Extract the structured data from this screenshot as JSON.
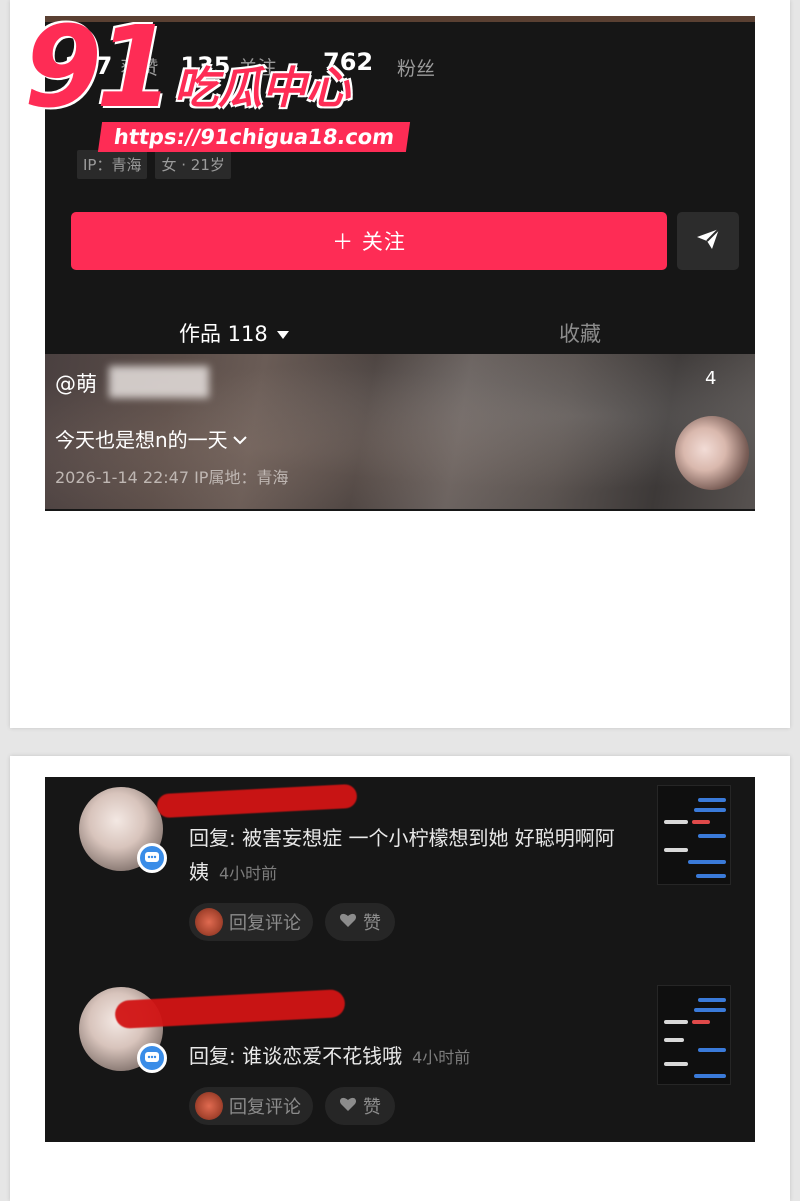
{
  "watermark": {
    "number": "91",
    "brand": "吃瓜中心",
    "url": "https://91chigua18.com"
  },
  "profile": {
    "stats": [
      {
        "num": "2?7",
        "label": "获赞"
      },
      {
        "num": "135",
        "label": "关注"
      },
      {
        "num": "762",
        "label": "粉丝"
      }
    ],
    "tags": [
      "IP：青海",
      "女 · 21岁"
    ],
    "follow_label": "＋ 关注",
    "tabs": {
      "works": "作品 118",
      "favorites": "收藏"
    }
  },
  "video": {
    "author": "@萌",
    "count": "4",
    "caption": "今天也是想n的一天",
    "meta": "2026-1-14 22:47  IP属地：青海"
  },
  "comments": [
    {
      "text": "回复: 被害妄想症 一个小柠檬想到她 好聪明啊阿姨",
      "time": "4小时前",
      "reply_label": "回复评论",
      "like_label": "赞"
    },
    {
      "text": "回复: 谁谈恋爱不花钱哦",
      "time": "4小时前",
      "reply_label": "回复评论",
      "like_label": "赞"
    }
  ],
  "colors": {
    "accent": "#fe2c55",
    "dark_bg": "#161616",
    "redaction": "#d21414"
  }
}
